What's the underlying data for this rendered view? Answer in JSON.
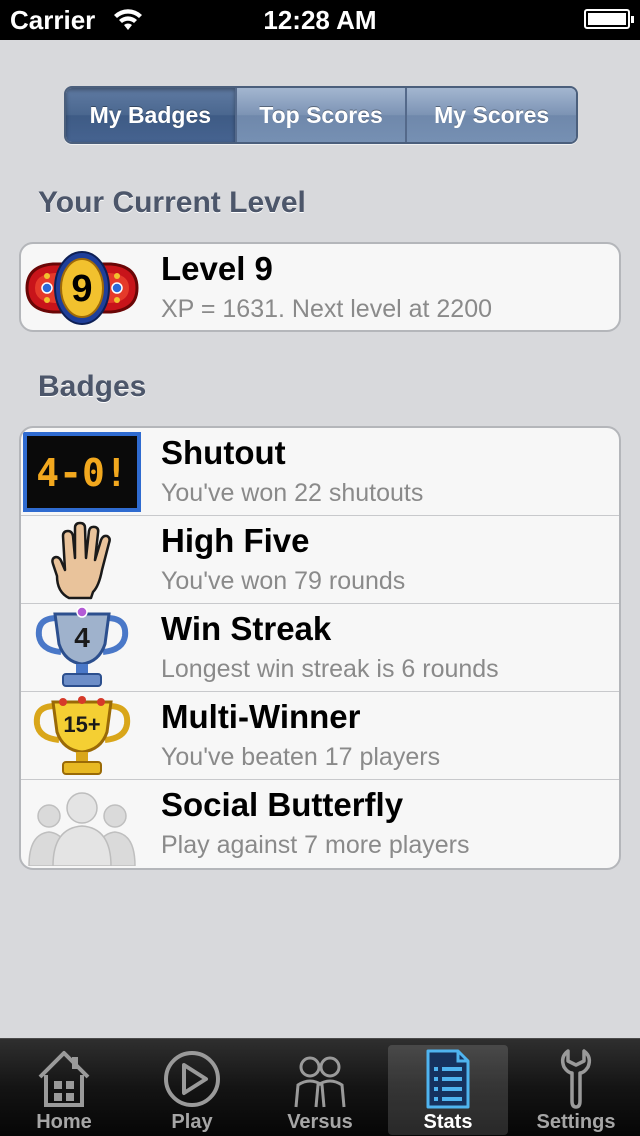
{
  "status_bar": {
    "carrier": "Carrier",
    "time": "12:28 AM"
  },
  "segments": [
    {
      "label": "My Badges",
      "selected": true
    },
    {
      "label": "Top Scores",
      "selected": false
    },
    {
      "label": "My Scores",
      "selected": false
    }
  ],
  "level_section": {
    "title": "Your Current Level",
    "badge_number": "9",
    "level_title": "Level 9",
    "level_detail": "XP = 1631. Next level at 2200"
  },
  "badges_section": {
    "title": "Badges",
    "items": [
      {
        "title": "Shutout",
        "subtitle": "You've won 22 shutouts",
        "icon": "scoreboard-icon",
        "icon_text": "4-0!"
      },
      {
        "title": "High Five",
        "subtitle": "You've won 79 rounds",
        "icon": "hand-icon"
      },
      {
        "title": "Win Streak",
        "subtitle": "Longest win streak is 6 rounds",
        "icon": "silver-trophy-icon",
        "icon_text": "4"
      },
      {
        "title": "Multi-Winner",
        "subtitle": "You've beaten 17 players",
        "icon": "gold-trophy-icon",
        "icon_text": "15+"
      },
      {
        "title": "Social Butterfly",
        "subtitle": "Play against 7 more players",
        "icon": "people-silhouette-icon"
      }
    ]
  },
  "tab_bar": {
    "tabs": [
      {
        "label": "Home",
        "icon": "home-icon",
        "selected": false
      },
      {
        "label": "Play",
        "icon": "play-icon",
        "selected": false
      },
      {
        "label": "Versus",
        "icon": "versus-icon",
        "selected": false
      },
      {
        "label": "Stats",
        "icon": "stats-icon",
        "selected": true
      },
      {
        "label": "Settings",
        "icon": "wrench-icon",
        "selected": false
      }
    ]
  }
}
